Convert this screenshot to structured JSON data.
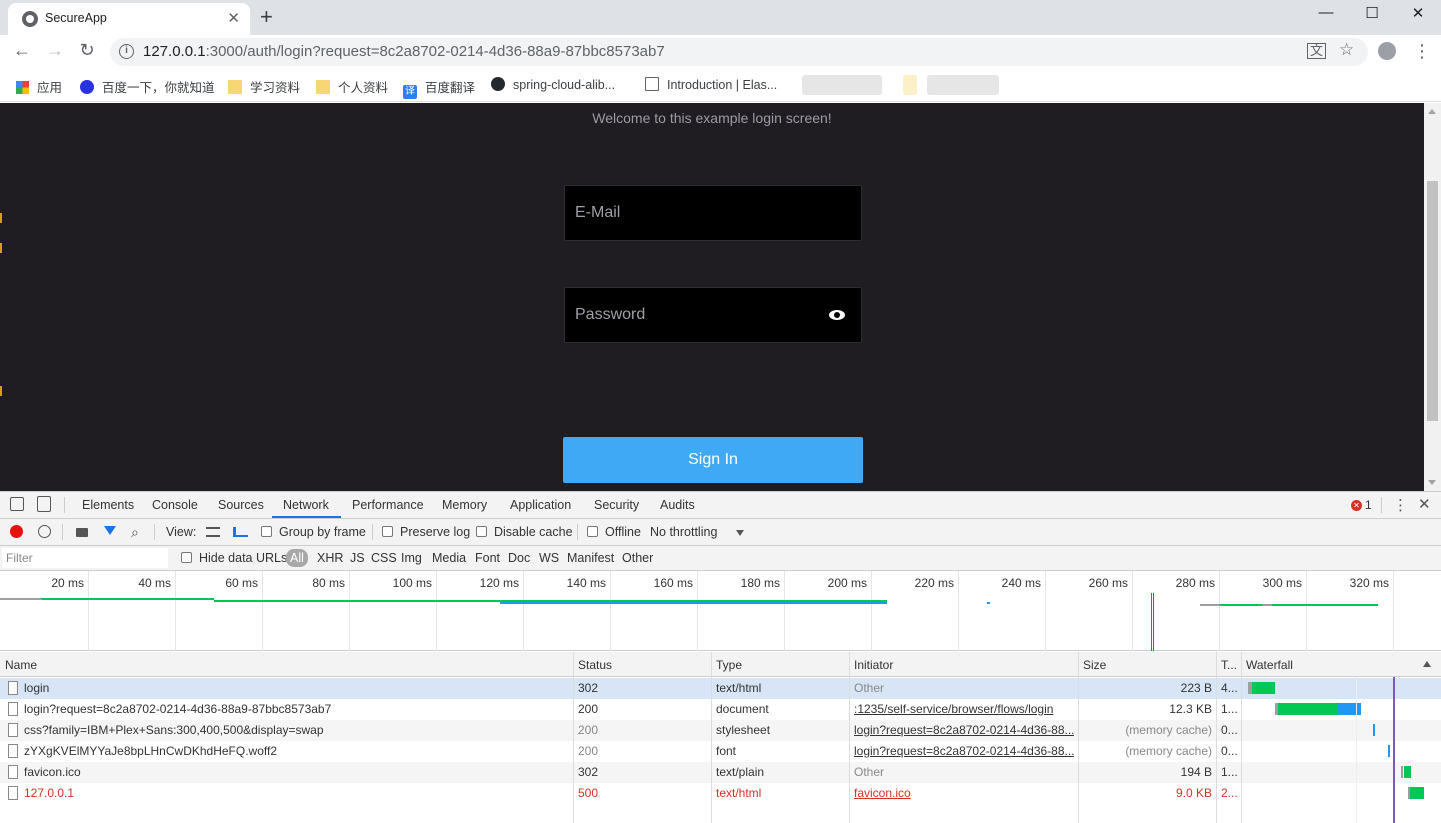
{
  "browser": {
    "tab_title": "SecureApp",
    "tab_close": "✕",
    "new_tab": "+",
    "window_controls": [
      "—",
      "☐",
      "✕"
    ],
    "url_host": "127.0.0.1",
    "url_rest": ":3000/auth/login?request=8c2a8702-0214-4d36-88a9-87bbc8573ab7",
    "back": "←",
    "forward": "→",
    "reload": "↻",
    "star": "☆",
    "menu": "⋮",
    "translate": "文"
  },
  "bookmarks": [
    {
      "label": "应用",
      "icon": "apps-grid-icon"
    },
    {
      "label": "百度一下，你就知道",
      "icon": "baidu-paw-icon"
    },
    {
      "label": "学习资料",
      "icon": "folder-icon"
    },
    {
      "label": "个人资料",
      "icon": "folder-icon"
    },
    {
      "label": "百度翻译",
      "icon": "translate-icon",
      "glyph": "译"
    },
    {
      "label": "spring-cloud-alib...",
      "icon": "github-icon"
    },
    {
      "label": "Introduction | Elas...",
      "icon": "book-icon"
    }
  ],
  "page": {
    "welcome": "Welcome to this example login screen!",
    "email_placeholder": "E-Mail",
    "password_placeholder": "Password",
    "signin_label": "Sign In"
  },
  "devtools": {
    "tabs": [
      "Elements",
      "Console",
      "Sources",
      "Network",
      "Performance",
      "Memory",
      "Application",
      "Security",
      "Audits"
    ],
    "active_tab": "Network",
    "error_count": "1",
    "toolbar": {
      "view_label": "View:",
      "group_by_frame": "Group by frame",
      "preserve_log": "Preserve log",
      "disable_cache": "Disable cache",
      "offline": "Offline",
      "throttling": "No throttling"
    },
    "filter": {
      "placeholder": "Filter",
      "hide_data_urls": "Hide data URLs",
      "types": [
        "All",
        "XHR",
        "JS",
        "CSS",
        "Img",
        "Media",
        "Font",
        "Doc",
        "WS",
        "Manifest",
        "Other"
      ]
    },
    "overview_ticks": [
      "20 ms",
      "40 ms",
      "60 ms",
      "80 ms",
      "100 ms",
      "120 ms",
      "140 ms",
      "160 ms",
      "180 ms",
      "200 ms",
      "220 ms",
      "240 ms",
      "260 ms",
      "280 ms",
      "300 ms",
      "320 ms"
    ],
    "columns": [
      "Name",
      "Status",
      "Type",
      "Initiator",
      "Size",
      "T...",
      "Waterfall"
    ],
    "rows": [
      {
        "name": "login",
        "status": "302",
        "type": "text/html",
        "initiator": "Other",
        "size": "223 B",
        "time": "4...",
        "selected": true,
        "error": false,
        "dim": false,
        "init_link": false
      },
      {
        "name": "login?request=8c2a8702-0214-4d36-88a9-87bbc8573ab7",
        "status": "200",
        "type": "document",
        "initiator": ":1235/self-service/browser/flows/login",
        "size": "12.3 KB",
        "time": "1...",
        "selected": false,
        "error": false,
        "dim": false,
        "init_link": true
      },
      {
        "name": "css?family=IBM+Plex+Sans:300,400,500&display=swap",
        "status": "200",
        "type": "stylesheet",
        "initiator": "login?request=8c2a8702-0214-4d36-88...",
        "size": "(memory cache)",
        "time": "0...",
        "selected": false,
        "error": false,
        "dim": true,
        "init_link": true
      },
      {
        "name": "zYXgKVElMYYaJe8bpLHnCwDKhdHeFQ.woff2",
        "status": "200",
        "type": "font",
        "initiator": "login?request=8c2a8702-0214-4d36-88...",
        "size": "(memory cache)",
        "time": "0...",
        "selected": false,
        "error": false,
        "dim": true,
        "init_link": true
      },
      {
        "name": "favicon.ico",
        "status": "302",
        "type": "text/plain",
        "initiator": "Other",
        "size": "194 B",
        "time": "1...",
        "selected": false,
        "error": false,
        "dim": false,
        "init_link": false
      },
      {
        "name": "127.0.0.1",
        "status": "500",
        "type": "text/html",
        "initiator": "favicon.ico",
        "size": "9.0 KB",
        "time": "2...",
        "selected": false,
        "error": true,
        "dim": false,
        "init_link": true
      }
    ],
    "colors": {
      "accent": "#1a73e8",
      "error": "#d93025",
      "record": "#e8110f",
      "waterfall_green": "#00c853",
      "waterfall_blue": "#2196f3"
    }
  }
}
